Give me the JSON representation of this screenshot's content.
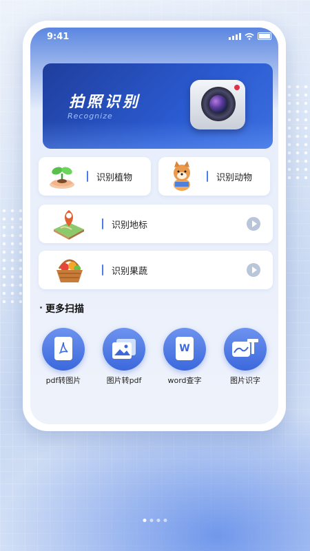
{
  "status": {
    "time": "9:41"
  },
  "banner": {
    "title": "拍照识别",
    "subtitle": "Recognize",
    "icon": "camera-icon"
  },
  "features": [
    {
      "label": "识别植物",
      "icon": "plant-icon"
    },
    {
      "label": "识别动物",
      "icon": "dog-icon"
    },
    {
      "label": "识别地标",
      "icon": "map-pin-icon"
    },
    {
      "label": "识别果蔬",
      "icon": "fruit-basket-icon"
    }
  ],
  "more": {
    "title": "更多扫描",
    "tools": [
      {
        "label": "pdf转图片",
        "icon": "pdf-icon"
      },
      {
        "label": "图片转pdf",
        "icon": "image-icon"
      },
      {
        "label": "word查字",
        "icon": "word-icon",
        "glyph": "W"
      },
      {
        "label": "图片识字",
        "icon": "image-text-icon"
      }
    ]
  },
  "colors": {
    "accent": "#3c68dc",
    "banner": "#2b5bd1"
  },
  "pager": {
    "count": 4,
    "active": 1
  }
}
